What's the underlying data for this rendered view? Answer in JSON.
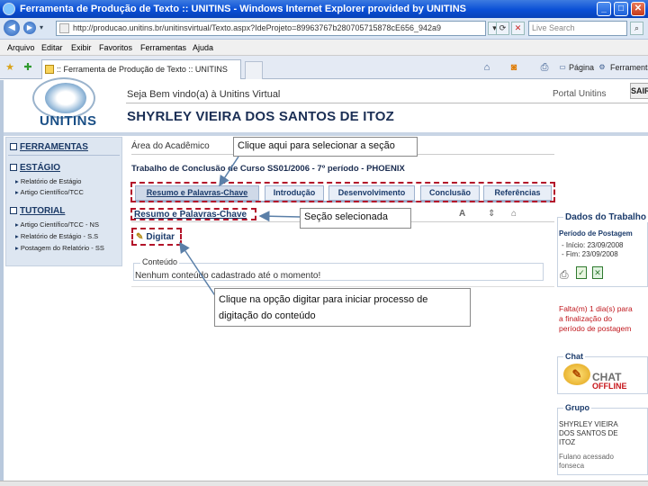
{
  "window": {
    "title": "Ferramenta de Produção de Texto :: UNITINS - Windows Internet Explorer provided by UNITINS",
    "min": "_",
    "max": "□",
    "close": "✕"
  },
  "addressbar": {
    "url": "http://producao.unitins.br/unitinsvirtual/Texto.aspx?IdeProjeto=89963767b280705715878cE656_942a9",
    "search_placeholder": "Live Search"
  },
  "menubar": {
    "items": [
      "Arquivo",
      "Editar",
      "Exibir",
      "Favoritos",
      "Ferramentas",
      "Ajuda"
    ]
  },
  "tabbar": {
    "tab_title": ":: Ferramenta de Produção de Texto :: UNITINS",
    "page_label": "Página",
    "tools_label": "Ferramentas"
  },
  "header": {
    "logo": "UNITINS",
    "welcome": "Seja Bem vindo(a) à Unitins Virtual",
    "portal": "Portal Unitins",
    "sair": "SAIR",
    "user_name": "SHYRLEY VIEIRA DOS SANTOS DE ITOZ"
  },
  "sidebar": {
    "title": "FERRAMENTAS",
    "sections": [
      {
        "label": "ESTÁGIO",
        "items": [
          "Relatório de Estágio",
          "Artigo Científico/TCC"
        ]
      },
      {
        "label": "TUTORIAL",
        "items": [
          "Artigo Científico/TCC - NS",
          "Relatório de Estágio - S.S",
          "Postagem do Relatório - SS"
        ]
      }
    ]
  },
  "main": {
    "area": "Área do Acadêmico",
    "work_title": "Trabalho de Conclusão de Curso SS01/2006 - 7º período - PHOENIX",
    "tabs": [
      "Resumo e Palavras-Chave",
      "Introdução",
      "Desenvolvimento",
      "Conclusão",
      "Referências"
    ],
    "section_title": "Resumo e Palavras-Chave",
    "digitar": "Digitar",
    "content_legend": "Conteúdo",
    "content_text": "Nenhum conteúdo cadastrado até o momento!"
  },
  "callouts": {
    "tabs": "Clique aqui para selecionar a seção",
    "section": "Seção selecionada",
    "digitar": "Clique na opção digitar para iniciar processo de digitação do conteúdo"
  },
  "rightpanel": {
    "dados_title": "Dados do Trabalho",
    "periodo": "Período de Postagem",
    "inicio": "- Início: 23/09/2008",
    "fim": "- Fim: 23/09/2008",
    "alert_l1": "Falta(m) 1 dia(s) para",
    "alert_l2": "a finalização do",
    "alert_l3": "período de postagem",
    "chat_title": "Chat",
    "chat_word": "CHAT",
    "chat_status": "OFFLINE",
    "grupo_title": "Grupo",
    "grupo_l1": "SHYRLEY VIEIRA",
    "grupo_l2": "DOS SANTOS DE",
    "grupo_l3": "ITOZ",
    "grupo_l4": "Fulano acessado",
    "grupo_l5": "fonseca"
  }
}
